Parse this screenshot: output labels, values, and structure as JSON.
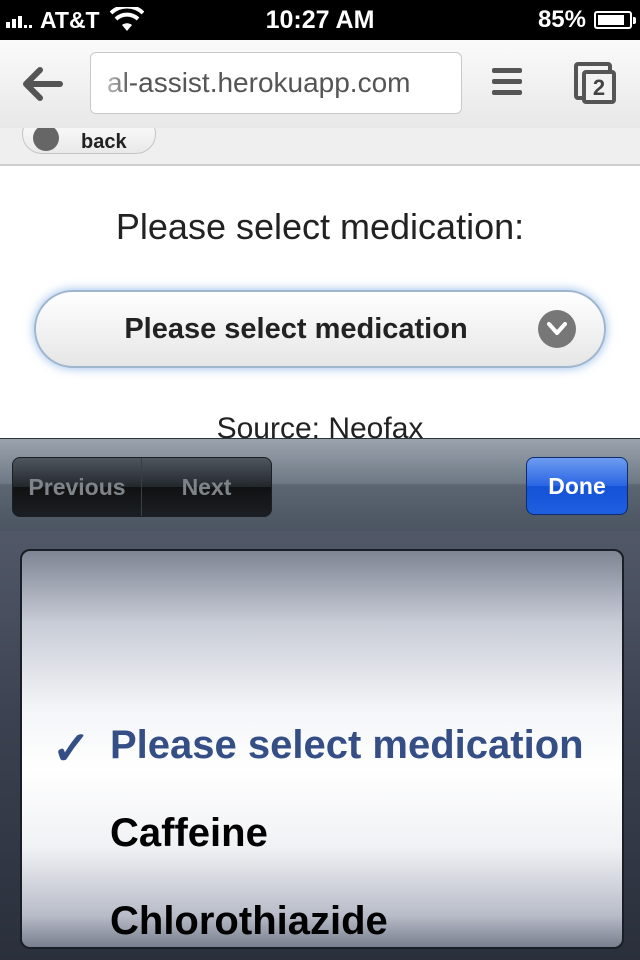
{
  "status_bar": {
    "carrier": "AT&T",
    "time": "10:27 AM",
    "battery_percent": "85%",
    "battery_level": 0.85
  },
  "browser": {
    "url_text": "al-assist.herokuapp.com",
    "tab_count": "2"
  },
  "page": {
    "back_label": "back",
    "prompt": "Please select medication:",
    "select_value": "Please select medication",
    "source": "Source: Neofax"
  },
  "toolbar": {
    "previous_label": "Previous",
    "next_label": "Next",
    "done_label": "Done"
  },
  "picker": {
    "check_mark": "✓",
    "options": [
      "Please select medication",
      "Caffeine",
      "Chlorothiazide"
    ],
    "selected_index": 0
  },
  "colors": {
    "selected_option": "#354f86",
    "done_button": "#1f5fe0"
  }
}
